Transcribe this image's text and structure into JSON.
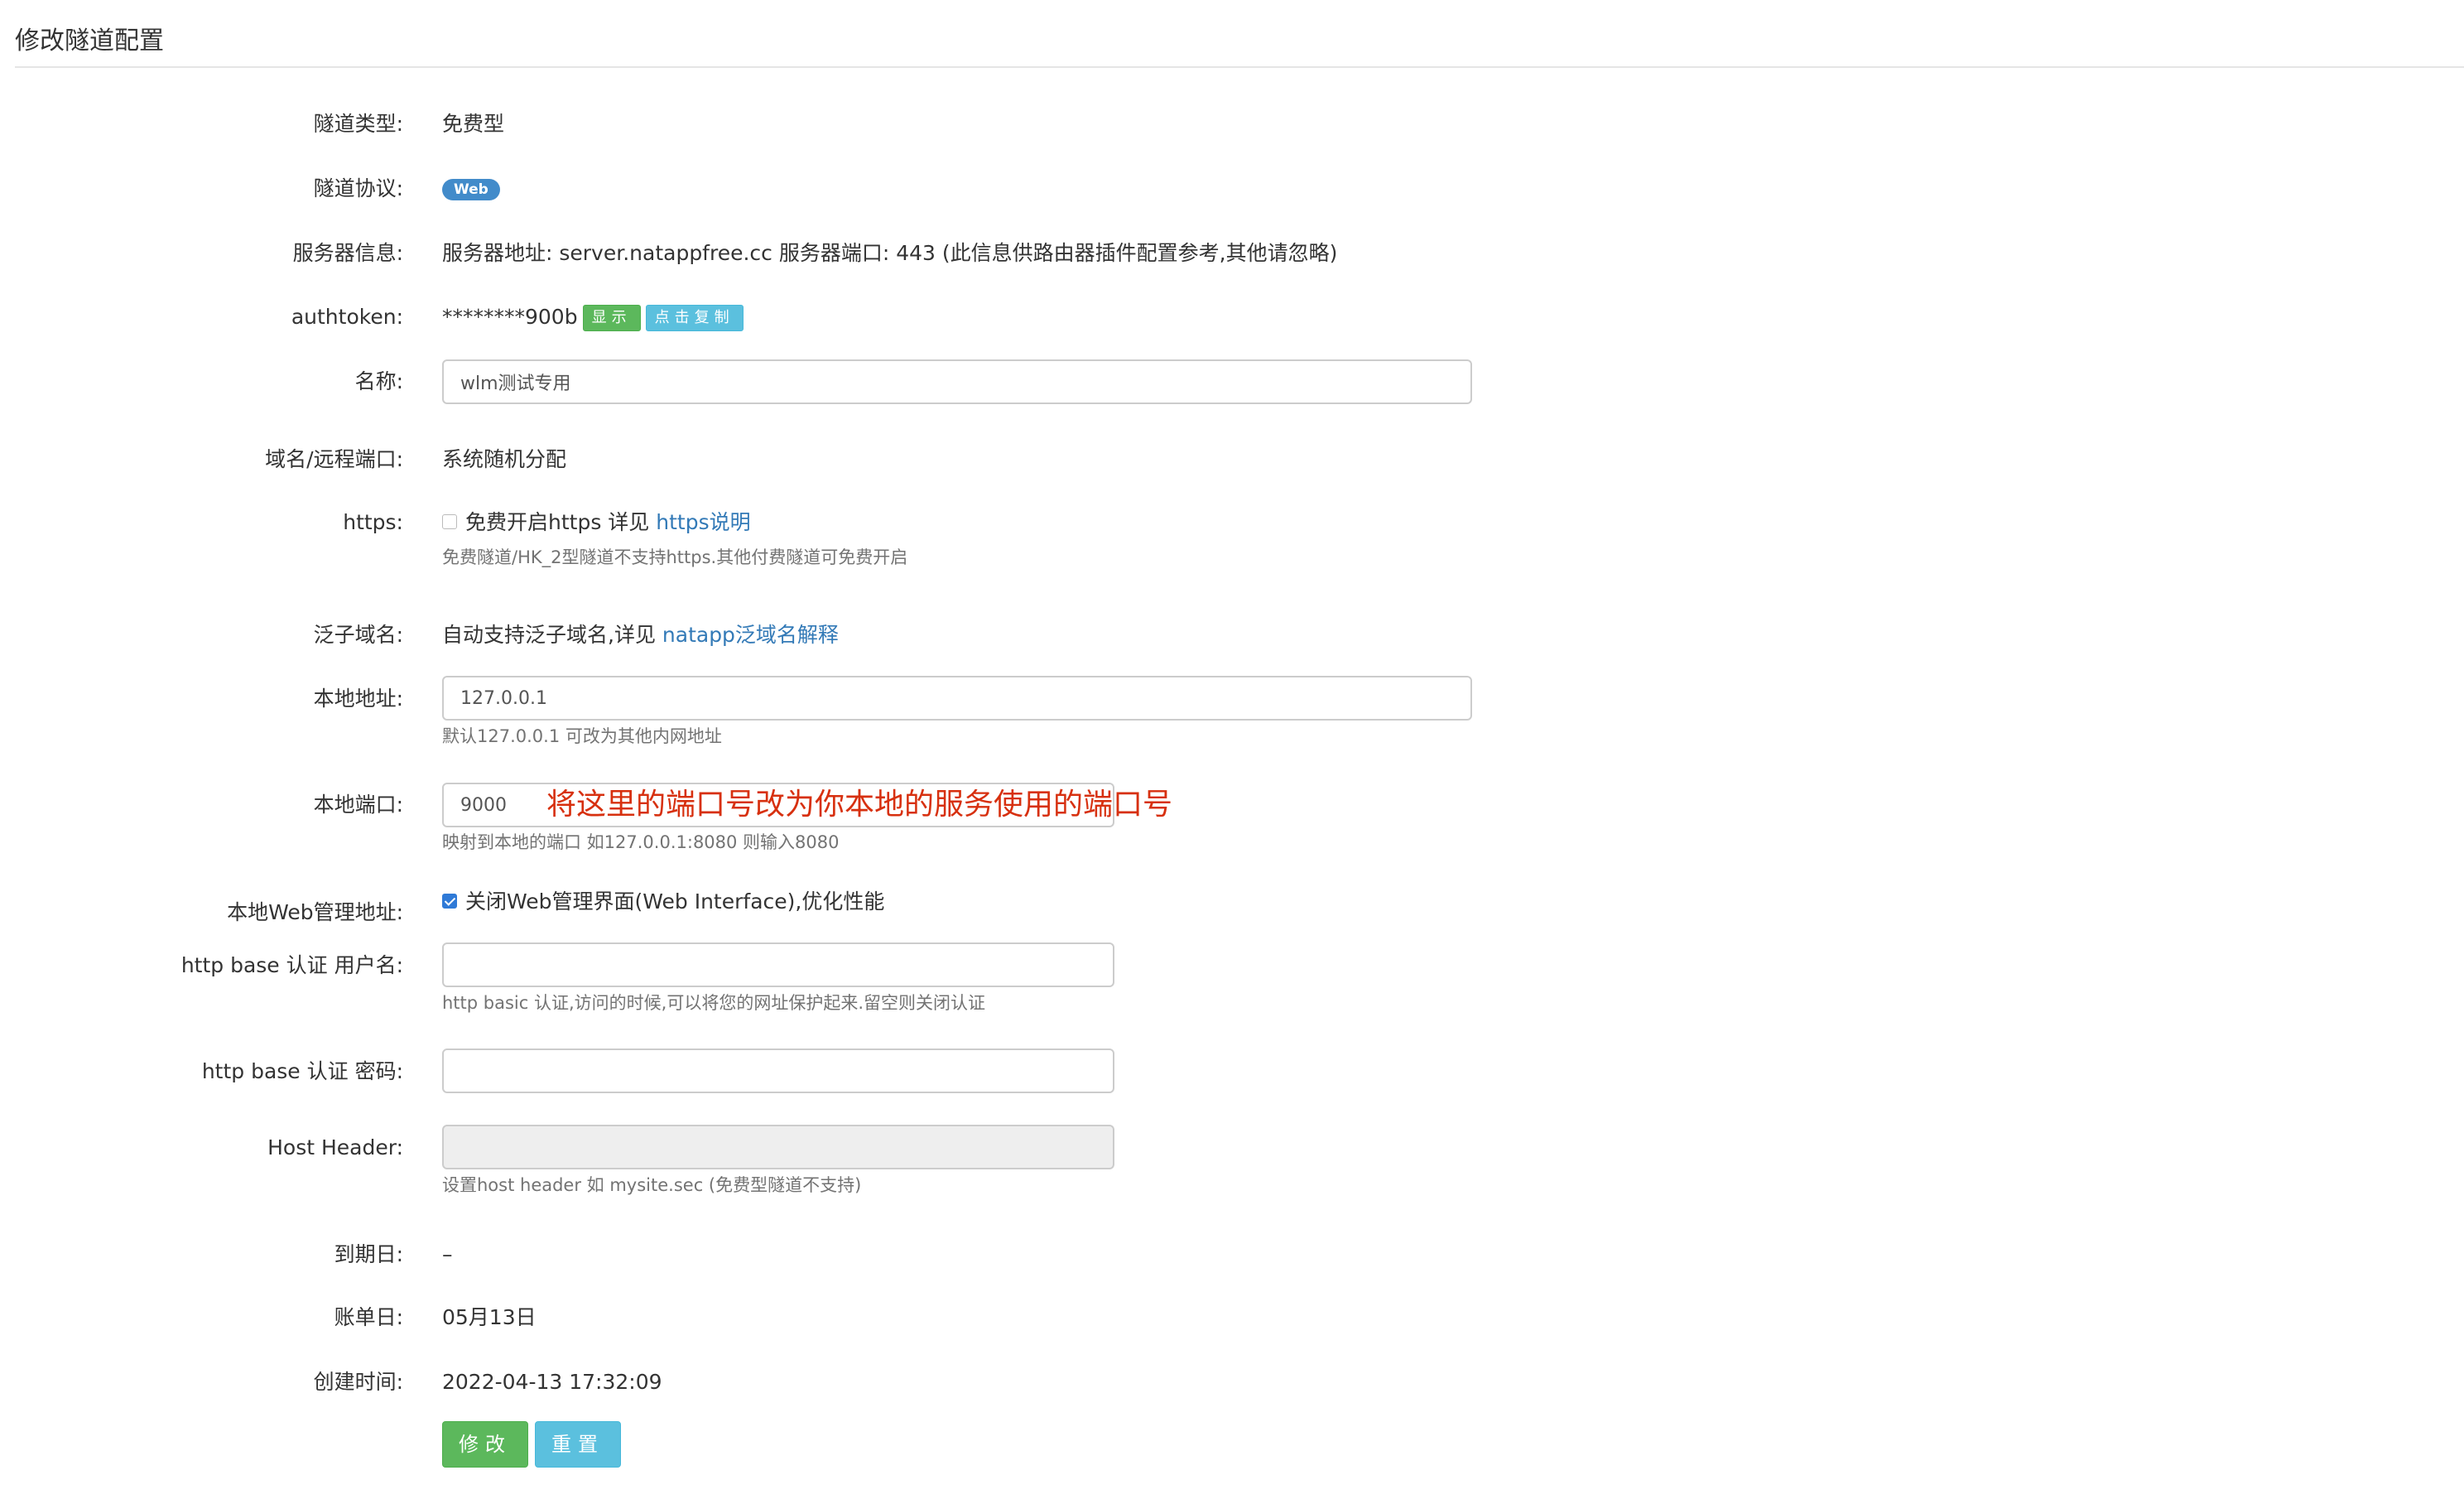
{
  "page_title": "修改隧道配置",
  "fields": {
    "tunnel_type": {
      "label": "隧道类型:",
      "value": "免费型"
    },
    "protocol": {
      "label": "隧道协议:",
      "badge": "Web"
    },
    "server_info": {
      "label": "服务器信息:",
      "value": "服务器地址: server.natappfree.cc 服务器端口: 443 (此信息供路由器插件配置参考,其他请忽略)"
    },
    "authtoken": {
      "label": "authtoken:",
      "value": "********900b",
      "show_label": "显示",
      "copy_label": "点击复制"
    },
    "name": {
      "label": "名称:",
      "value": "wlm测试专用"
    },
    "domain_port": {
      "label": "域名/远程端口:",
      "value": "系统随机分配"
    },
    "https": {
      "label": "https:",
      "checkbox_text": "免费开启https 详见 ",
      "link": "https说明",
      "help": "免费隧道/HK_2型隧道不支持https.其他付费隧道可免费开启",
      "checked": false
    },
    "wildcard": {
      "label": "泛子域名:",
      "text": "自动支持泛子域名,详见 ",
      "link": "natapp泛域名解释"
    },
    "local_addr": {
      "label": "本地地址:",
      "value": "127.0.0.1",
      "help": "默认127.0.0.1 可改为其他内网地址"
    },
    "local_port": {
      "label": "本地端口:",
      "value": "9000",
      "help": "映射到本地的端口 如127.0.0.1:8080 则输入8080",
      "annotation": "将这里的端口号改为你本地的服务使用的端口号"
    },
    "web_admin": {
      "label": "本地Web管理地址:",
      "checkbox_text": "关闭Web管理界面(Web Interface),优化性能",
      "checked": true
    },
    "basic_user": {
      "label": "http base 认证 用户名:",
      "value": "",
      "help": "http basic 认证,访问的时候,可以将您的网址保护起来.留空则关闭认证"
    },
    "basic_pass": {
      "label": "http base 认证 密码:",
      "value": ""
    },
    "host_header": {
      "label": "Host Header:",
      "value": "",
      "help": "设置host header 如 mysite.sec (免费型隧道不支持)"
    },
    "expire": {
      "label": "到期日:",
      "value": "–"
    },
    "bill_day": {
      "label": "账单日:",
      "value": "05月13日"
    },
    "created": {
      "label": "创建时间:",
      "value": "2022-04-13 17:32:09"
    }
  },
  "buttons": {
    "submit": "修改",
    "reset": "重置"
  },
  "colors": {
    "primary_link": "#337ab7",
    "success": "#5cb85c",
    "info": "#5bc0de",
    "annotation": "#d7300f"
  }
}
